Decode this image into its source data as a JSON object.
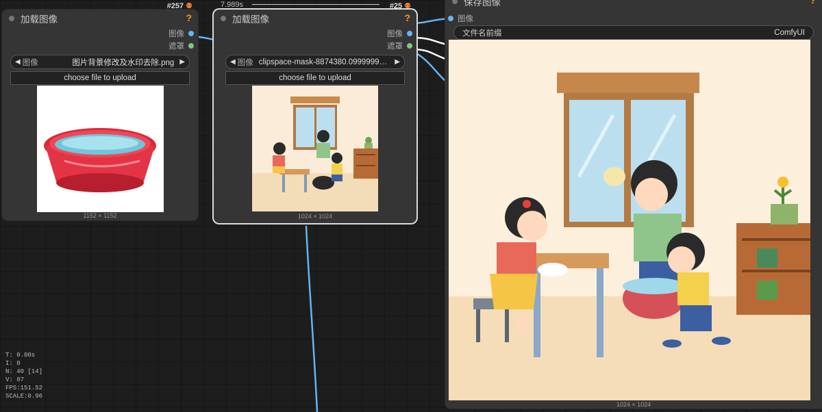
{
  "node1": {
    "id_badge": "#257",
    "title": "加载图像",
    "help": "?",
    "outputs": [
      "图像",
      "遮罩"
    ],
    "combo": {
      "arrow_left": "◀",
      "name": "图像",
      "value": "图片背景修改及水印去除.png",
      "arrow_right": "▶"
    },
    "upload_label": "choose file to upload",
    "dims": "1152 × 1152"
  },
  "node2": {
    "timer": "7.989s",
    "id_badge": "#25",
    "title": "加载图像",
    "help": "?",
    "outputs": [
      "图像",
      "遮罩"
    ],
    "combo": {
      "arrow_left": "◀",
      "name": "图像",
      "value": "clipspace-mask-8874380.09999999...",
      "arrow_right": "▶"
    },
    "upload_label": "choose file to upload",
    "dims": "1024 × 1024"
  },
  "node3": {
    "title": "保存图像",
    "help": "?",
    "input_label": "图像",
    "field": {
      "name": "文件名前缀",
      "value": "ComfyUI"
    },
    "dims": "1024 × 1024"
  },
  "stats": [
    "T: 0.00s",
    "I: 0",
    "N: 40 [14]",
    "V: 87",
    "FPS:151.52",
    "SCALE:0.96"
  ],
  "colors": {
    "wire_image": "#64b5f6",
    "wire_mask": "#ffffff",
    "slot_mask": "#7cc97c",
    "help": "#f0a020"
  }
}
